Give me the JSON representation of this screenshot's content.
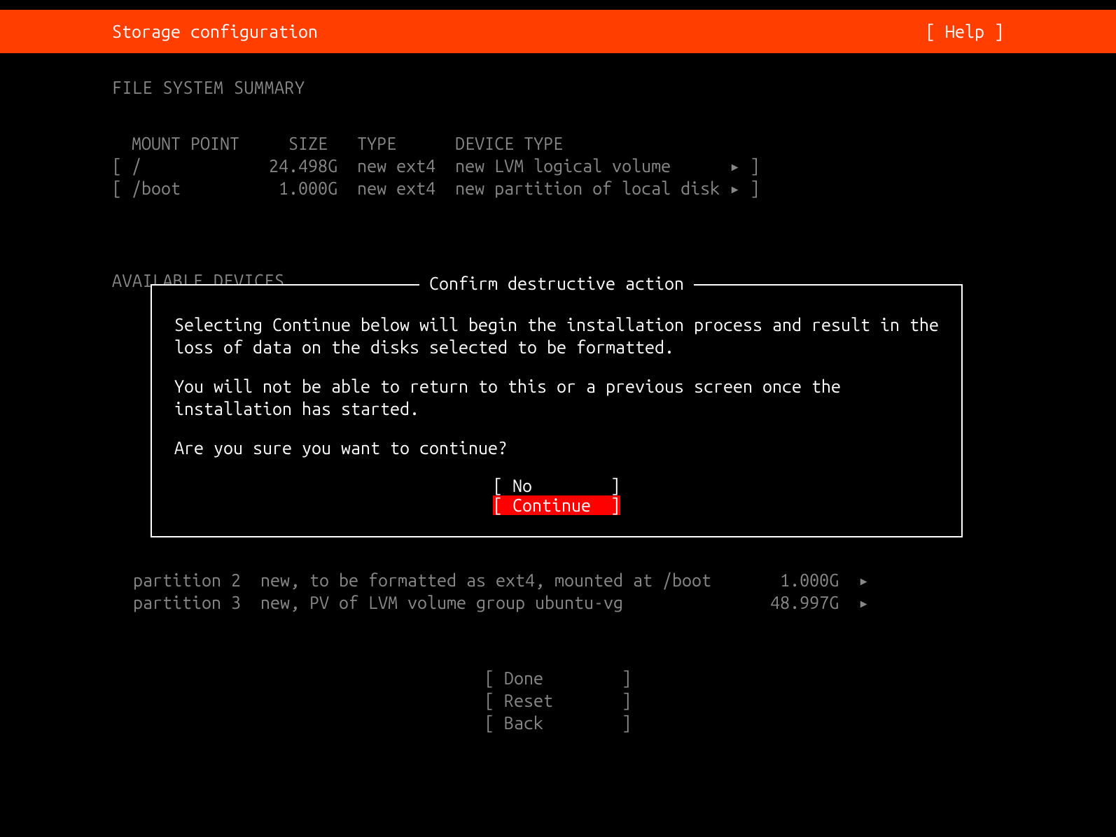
{
  "header": {
    "title": "Storage configuration",
    "help": "[ Help ]"
  },
  "sections": {
    "fs_summary": "FILE SYSTEM SUMMARY",
    "avail": "AVAILABLE DEVICES"
  },
  "fs_table": {
    "header": {
      "mount": "MOUNT POINT",
      "size": "SIZE",
      "type": "TYPE",
      "devtype": "DEVICE TYPE"
    },
    "rows": [
      {
        "mount": "/",
        "size": "24.498G",
        "type": "new ext4",
        "devtype": "new LVM logical volume"
      },
      {
        "mount": "/boot",
        "size": "1.000G",
        "type": "new ext4",
        "devtype": "new partition of local disk"
      }
    ]
  },
  "dialog": {
    "title": "Confirm destructive action",
    "p1": "Selecting Continue below will begin the installation process and result in the loss of data on the disks selected to be formatted.",
    "p2": "You will not be able to return to this or a previous screen once the installation has started.",
    "p3": "Are you sure you want to continue?",
    "no": "No",
    "cont": "Continue"
  },
  "partitions": [
    {
      "name": "partition 2",
      "desc": "new, to be formatted as ext4, mounted at /boot",
      "size": "1.000G"
    },
    {
      "name": "partition 3",
      "desc": "new, PV of LVM volume group ubuntu-vg",
      "size": "48.997G"
    }
  ],
  "footer": {
    "done": "Done",
    "reset": "Reset",
    "back": "Back"
  },
  "arrow": "▸"
}
